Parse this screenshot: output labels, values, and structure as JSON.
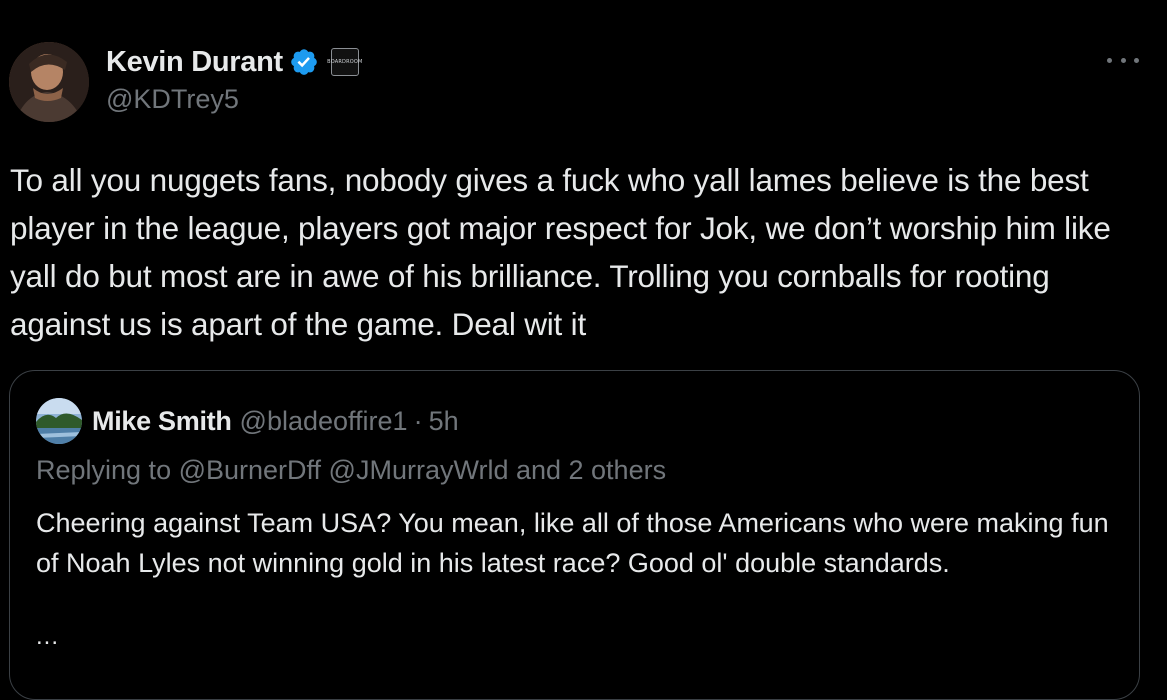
{
  "post": {
    "author": {
      "display_name": "Kevin Durant",
      "handle": "@KDTrey5",
      "verified_icon": "verified-badge-icon",
      "affiliation_badge_text": "BOARDROOM"
    },
    "more_icon": "more-options-icon",
    "text": "To all you nuggets fans, nobody gives a fuck who yall lames believe is the best player in the league, players got major respect for Jok, we don’t worship him like yall do but most are in awe of his brilliance. Trolling you cornballs for rooting against us is apart of the game. Deal wit it"
  },
  "quoted_post": {
    "author": {
      "display_name": "Mike Smith",
      "handle": "@bladeoffire1",
      "separator": "·",
      "time": "5h"
    },
    "replying_to": "Replying to @BurnerDff @JMurrayWrld and 2 others",
    "text": "Cheering against Team USA? You mean, like all of those Americans who were making fun of Noah Lyles not winning gold in his latest race? Good ol' double standards.",
    "ellipsis": "..."
  },
  "colors": {
    "background": "#000000",
    "primary_text": "#e7e9ea",
    "secondary_text": "#71767b",
    "verified_blue": "#1d9bf0",
    "border": "#3b4045"
  }
}
